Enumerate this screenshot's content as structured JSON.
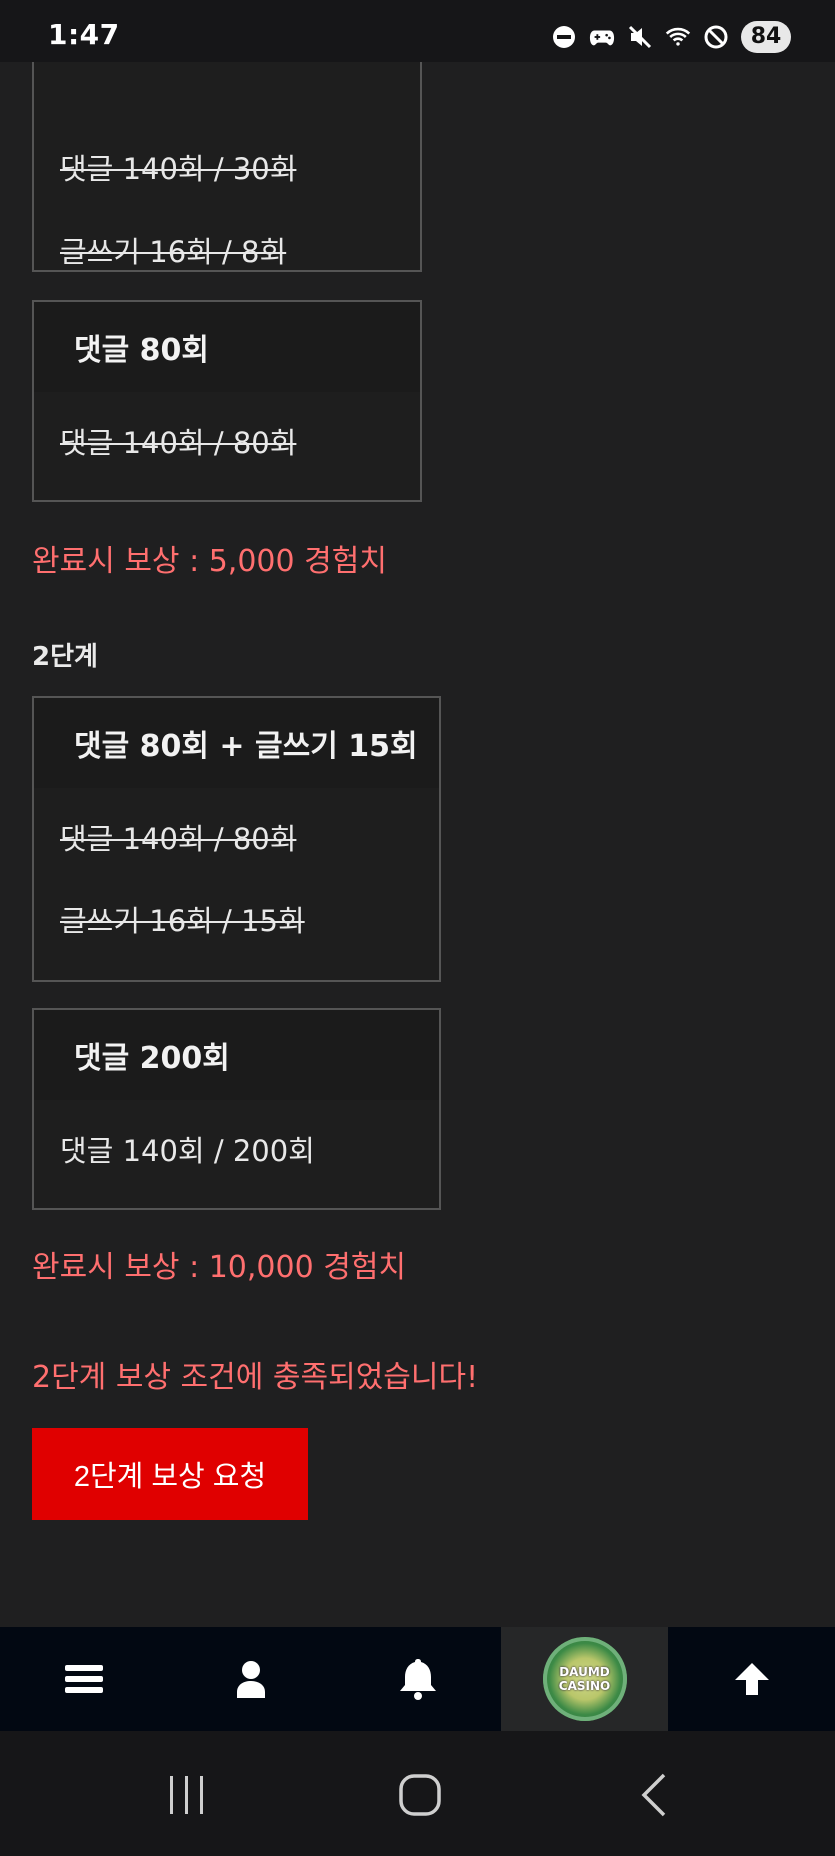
{
  "status_bar": {
    "time": "1:47",
    "battery": "84",
    "icons": [
      "dnd-icon",
      "gamepad-icon",
      "mute-icon",
      "wifi-icon",
      "block-icon"
    ]
  },
  "stage1": {
    "card_top": {
      "lines": [
        "댓글 140회 / 30회",
        "글쓰기 16회 / 8회"
      ]
    },
    "card_comment80": {
      "title": "댓글 80회",
      "line": "댓글 140회 / 80회"
    },
    "reward": "완료시 보상 : 5,000 경험치"
  },
  "stage2": {
    "title": "2단계",
    "card_combo": {
      "title": "댓글 80회 + 글쓰기 15회",
      "lines": [
        "댓글 140회 / 80회",
        "글쓰기 16회 / 15회"
      ]
    },
    "card_comment200": {
      "title": "댓글 200회",
      "line": "댓글 140회 / 200회"
    },
    "reward": "완료시 보상 : 10,000 경험치",
    "notice": "2단계 보상 조건에 충족되었습니다!",
    "request_button": "2단계 보상 요청"
  },
  "bottom_nav": {
    "items": [
      "menu-icon",
      "user-icon",
      "bell-icon",
      "daumd-casino-logo",
      "arrow-up-icon"
    ],
    "logo_text_line1": "DAUMD",
    "logo_text_line2": "CASINO"
  },
  "colors": {
    "background": "#1f1f20",
    "accent_red": "#e00000",
    "reward_text": "#ff6f6f"
  }
}
